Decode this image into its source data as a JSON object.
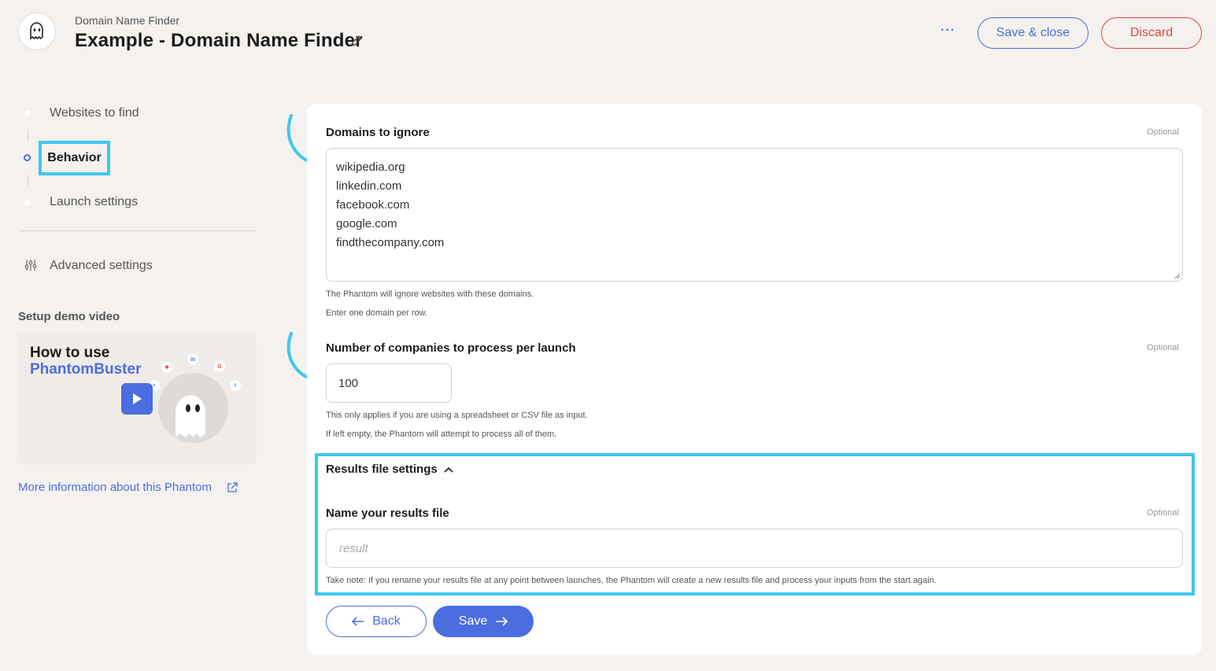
{
  "header": {
    "subtitle": "Domain Name Finder",
    "title": "Example - Domain Name Finder",
    "more_label": "···",
    "save_close_label": "Save & close",
    "discard_label": "Discard"
  },
  "sidebar": {
    "steps": [
      {
        "label": "Websites to find",
        "active": false
      },
      {
        "label": "Behavior",
        "active": true
      },
      {
        "label": "Launch settings",
        "active": false
      }
    ],
    "advanced_label": "Advanced settings",
    "demo_title": "Setup demo video",
    "video": {
      "line1": "How to use",
      "line2": "PhantomBuster"
    },
    "more_info_label": "More information about this Phantom"
  },
  "main": {
    "domains": {
      "label": "Domains to ignore",
      "optional": "Optional",
      "lines": [
        "wikipedia.org",
        "linkedin.com",
        "facebook.com",
        "google.com",
        "findthecompany.com"
      ],
      "help1": "The Phantom will ignore websites with these domains.",
      "help2": "Enter one domain per row."
    },
    "companies": {
      "label": "Number of companies to process per launch",
      "optional": "Optional",
      "value": "100",
      "help1": "This only applies if you are using a spreadsheet or CSV file as input.",
      "help2": "If left empty, the Phantom will attempt to process all of them."
    },
    "results": {
      "section_label": "Results file settings",
      "name_label": "Name your results file",
      "optional": "Optional",
      "placeholder": "result",
      "note": "Take note: If you rename your results file at any point between launches, the Phantom will create a new results file and process your inputs from the start again."
    },
    "back_label": "Back",
    "save_label": "Save"
  },
  "colors": {
    "accent": "#4a6ee0",
    "danger": "#e2463b",
    "highlight": "#3fc7ee",
    "background": "#f4f1ee"
  }
}
